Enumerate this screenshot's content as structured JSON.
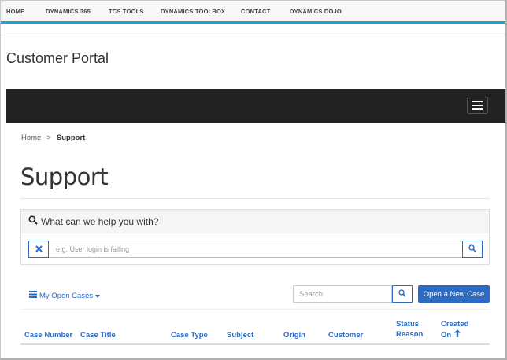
{
  "topnav": {
    "items": [
      "HOME",
      "DYNAMICS 365",
      "TCS TOOLS",
      "DYNAMICS TOOLBOX",
      "CONTACT",
      "DYNAMICS DOJO"
    ]
  },
  "site": {
    "title": "Customer Portal"
  },
  "breadcrumb": {
    "home": "Home",
    "separator": ">",
    "current": "Support"
  },
  "page": {
    "title": "Support"
  },
  "kb_search": {
    "question": "What can we help you with?",
    "placeholder": "e.g. User login is failing"
  },
  "cases": {
    "view_label": "My Open Cases",
    "search_placeholder": "Search",
    "new_case_label": "Open a New Case",
    "columns": [
      {
        "line1": "Case Number",
        "line2": ""
      },
      {
        "line1": "Case Title",
        "line2": ""
      },
      {
        "line1": "Case Type",
        "line2": ""
      },
      {
        "line1": "Subject",
        "line2": ""
      },
      {
        "line1": "Origin",
        "line2": ""
      },
      {
        "line1": "Customer",
        "line2": ""
      },
      {
        "line1": "Status",
        "line2": "Reason"
      },
      {
        "line1": "Created",
        "line2": "On"
      }
    ]
  },
  "colors": {
    "accent": "#1ea0d9",
    "primary": "#2b6bc6",
    "dark_bar": "#222222"
  }
}
